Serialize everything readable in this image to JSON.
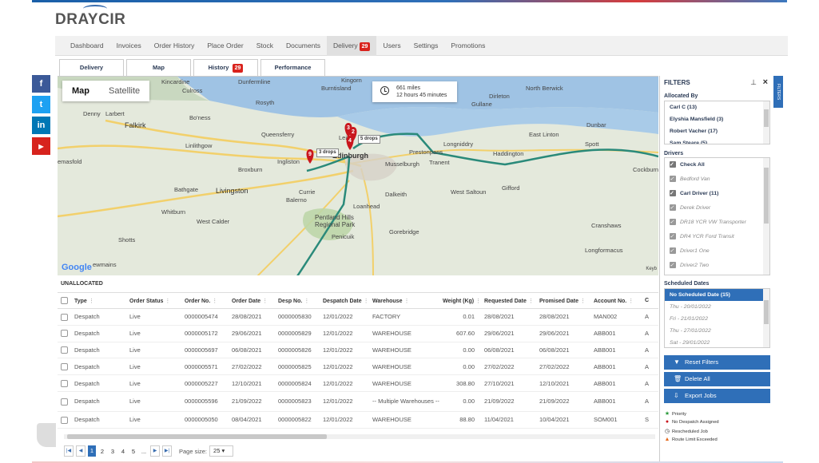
{
  "brand": {
    "name": "DRAYCIR"
  },
  "nav": [
    {
      "label": "Dashboard"
    },
    {
      "label": "Invoices"
    },
    {
      "label": "Order History"
    },
    {
      "label": "Place Order"
    },
    {
      "label": "Stock"
    },
    {
      "label": "Documents"
    },
    {
      "label": "Delivery",
      "badge": "29",
      "active": true
    },
    {
      "label": "Users"
    },
    {
      "label": "Settings"
    },
    {
      "label": "Promotions"
    }
  ],
  "subtabs": {
    "delivery": "Delivery",
    "map": "Map",
    "history": "History",
    "history_badge": "29",
    "performance": "Performance"
  },
  "social": {
    "facebook": "f",
    "twitter": "t",
    "linkedin": "in",
    "youtube": "▶"
  },
  "map": {
    "toggle_map": "Map",
    "toggle_satellite": "Satellite",
    "distance": "661 miles",
    "duration": "12 hours 45 minutes",
    "places": {
      "dunfermline": "Dunfermline",
      "kingorn": "Kingorn",
      "burntisland": "Burntisland",
      "north_berwick": "North Berwick",
      "dirleton": "Dirleton",
      "gullane": "Gullane",
      "kincardine": "Kincardine",
      "culross": "Culross",
      "rosyth": "Rosyth",
      "denny": "Denny",
      "larbert": "Larbert",
      "boness": "Bo'ness",
      "falkirk": "Falkirk",
      "linlithgow": "Linlithgow",
      "queensferry": "Queensferry",
      "dunbar": "Dunbar",
      "east_linton": "East Linton",
      "spott": "Spott",
      "longniddry": "Longniddry",
      "haddington": "Haddington",
      "prestonpans": "Prestonpans",
      "musselburgh": "Musselburgh",
      "tranent": "Tranent",
      "ingliston": "Ingliston",
      "edinburgh": "Edinburgh",
      "broxburn": "Broxburn",
      "cockburn": "Cockburn",
      "bathgate": "Bathgate",
      "livingston": "Livingston",
      "currie": "Currie",
      "balerno": "Balerno",
      "dalkeith": "Dalkeith",
      "west_saltoun": "West Saltoun",
      "gifford": "Gifford",
      "whitburn": "Whitburn",
      "west_calder": "West Calder",
      "loanhead": "Loanhead",
      "pentland": "Pentland Hills Regional Park",
      "gorebridge": "Gorebridge",
      "penicuik": "Penicuik",
      "cranshaws": "Cranshaws",
      "shotts": "Shotts",
      "longformacus": "Longformacus",
      "newmains": "ewmains",
      "emasfold": "emasfold",
      "leith": "Leith"
    },
    "markers": [
      {
        "num": "3"
      },
      {
        "num": "2"
      },
      {
        "num": "4"
      },
      {
        "num": "9"
      }
    ],
    "drops": [
      {
        "label": "5 drops"
      },
      {
        "label": "3 drops"
      }
    ],
    "roads": [
      "A985",
      "A90",
      "M90",
      "M9",
      "M9",
      "A8",
      "A71",
      "A720",
      "A7",
      "A68",
      "A1",
      "A1",
      "A199",
      "A6124",
      "A701",
      "A70",
      "M8",
      "M8",
      "A73",
      "A71",
      "A702",
      "A6093"
    ],
    "attribution": "Google",
    "keyboard": "Keyb"
  },
  "unallocated": {
    "title": "UNALLOCATED",
    "columns": [
      "Type",
      "Order Status",
      "Order No.",
      "Order Date",
      "Desp No.",
      "Despatch Date",
      "Warehouse",
      "Weight (Kg)",
      "Requested Date",
      "Promised Date",
      "Account No.",
      "C"
    ],
    "rows": [
      [
        "Despatch",
        "Live",
        "0000005474",
        "28/08/2021",
        "0000005830",
        "12/01/2022",
        "FACTORY",
        "0.01",
        "28/08/2021",
        "28/08/2021",
        "MAN002",
        "A"
      ],
      [
        "Despatch",
        "Live",
        "0000005172",
        "29/06/2021",
        "0000005829",
        "12/01/2022",
        "WAREHOUSE",
        "607.60",
        "29/06/2021",
        "29/06/2021",
        "ABB001",
        "A"
      ],
      [
        "Despatch",
        "Live",
        "0000005697",
        "06/08/2021",
        "0000005826",
        "12/01/2022",
        "WAREHOUSE",
        "0.00",
        "06/08/2021",
        "06/08/2021",
        "ABB001",
        "A"
      ],
      [
        "Despatch",
        "Live",
        "0000005571",
        "27/02/2022",
        "0000005825",
        "12/01/2022",
        "WAREHOUSE",
        "0.00",
        "27/02/2022",
        "27/02/2022",
        "ABB001",
        "A"
      ],
      [
        "Despatch",
        "Live",
        "0000005227",
        "12/10/2021",
        "0000005824",
        "12/01/2022",
        "WAREHOUSE",
        "308.80",
        "27/10/2021",
        "12/10/2021",
        "ABB001",
        "A"
      ],
      [
        "Despatch",
        "Live",
        "0000005596",
        "21/09/2022",
        "0000005823",
        "12/01/2022",
        "-- Multiple Warehouses --",
        "0.00",
        "21/09/2022",
        "21/09/2022",
        "ABB001",
        "A"
      ],
      [
        "Despatch",
        "Live",
        "0000005050",
        "08/04/2021",
        "0000005822",
        "12/01/2022",
        "WAREHOUSE",
        "88.80",
        "11/04/2021",
        "10/04/2021",
        "SOM001",
        "S"
      ]
    ],
    "pager": {
      "pages": [
        "1",
        "2",
        "3",
        "4",
        "5"
      ],
      "ellipsis": "...",
      "page_size_label": "Page size:",
      "page_size": "25"
    }
  },
  "filters": {
    "title": "FILTERS",
    "allocated_by_label": "Allocated By",
    "allocated_by": [
      "Carl C (13)",
      "Elyshia Mansfield (3)",
      "Robert Vacher (17)",
      "Sam Steare (5)"
    ],
    "drivers_label": "Drivers",
    "drivers": [
      {
        "name": "Check All",
        "style": "bold"
      },
      {
        "name": "Bedford Van",
        "style": "muted"
      },
      {
        "name": "Carl Driver (11)",
        "style": "bold"
      },
      {
        "name": "Derek Driver",
        "style": "muted"
      },
      {
        "name": "DR18 YCR VW Transporter",
        "style": "muted"
      },
      {
        "name": "DR4 YCR Ford Transit",
        "style": "muted"
      },
      {
        "name": "Driver1 One",
        "style": "muted"
      },
      {
        "name": "Driver2 Two",
        "style": "muted"
      }
    ],
    "scheduled_label": "Scheduled Dates",
    "scheduled": [
      "No Scheduled Date (15)",
      "Thu - 20/01/2022",
      "Fri - 21/01/2022",
      "Thu - 27/01/2022",
      "Sat - 29/01/2022"
    ],
    "buttons": {
      "reset": "Reset Filters",
      "delete": "Delete All",
      "export": "Export Jobs"
    },
    "legend": {
      "priority": "Priority",
      "no_despatch": "No Despatch Assigned",
      "rescheduled": "Rescheduled Job",
      "route_limit": "Route Limit Exceeded"
    },
    "side_tab": "FILTERS"
  },
  "colors": {
    "accent": "#2f6fb8",
    "badge": "#d9231d",
    "route": "#2a8a7a",
    "marker": "#c9161d"
  }
}
